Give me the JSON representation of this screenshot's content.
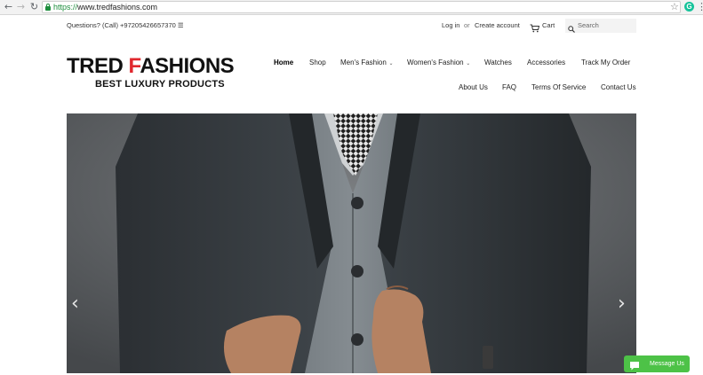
{
  "browser": {
    "url_scheme": "https://",
    "url_host": "www.tredfashions.com",
    "ext_letter": "G"
  },
  "topbar": {
    "questions": "Questions? (Call) +97205426657370 ☰",
    "login": "Log in",
    "or": "or",
    "create_account": "Create account",
    "cart": "Cart",
    "search_placeholder": "Search"
  },
  "logo": {
    "part1": "TRED ",
    "part2": "FASHIONS",
    "tagline": "BEST LUXURY PRODUCTS"
  },
  "nav": {
    "row1": [
      "Home",
      "Shop",
      "Men's Fashion",
      "Women's Fashion",
      "Watches",
      "Accessories",
      "Track My Order"
    ],
    "row2": [
      "About Us",
      "FAQ",
      "Terms Of Service",
      "Contact Us"
    ]
  },
  "slider": {
    "prev": "‹",
    "next": "›"
  },
  "chat": {
    "label": "Message Us"
  },
  "colors": {
    "brand_red": "#e0282e",
    "chat_green": "#4dc247",
    "secure_green": "#1e8e3e"
  }
}
